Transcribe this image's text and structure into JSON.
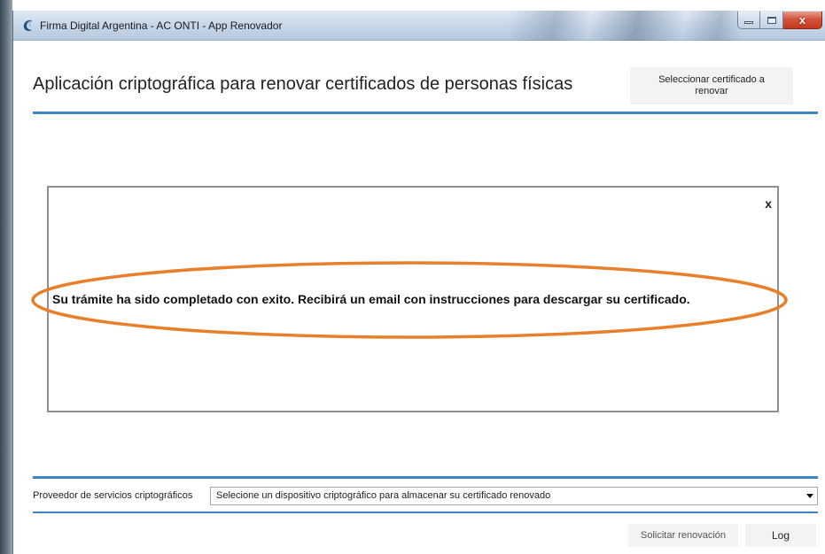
{
  "window": {
    "title": "Firma Digital Argentina - AC ONTI - App Renovador",
    "controls": {
      "minimize_icon": "minimize-icon",
      "maximize_icon": "maximize-icon",
      "close_label": "x"
    }
  },
  "header": {
    "title": "Aplicación criptográfica para renovar certificados de personas físicas",
    "select_cert_label": "Seleccionar certificado a renovar"
  },
  "dialog": {
    "close_label": "x",
    "message": "Su trámite ha sido completado con exito. Recibirá un email con instrucciones para descargar su certificado."
  },
  "provider": {
    "label": "Proveedor de servicios criptográficos",
    "selected": "Selecione un dispositivo criptográfico para almacenar su certificado renovado"
  },
  "footer": {
    "request_label": "Solicitar renovación",
    "log_label": "Log"
  },
  "colors": {
    "accent_rule": "#3d85c6",
    "highlight_ellipse": "#e8802b",
    "close_button": "#c7402a"
  }
}
